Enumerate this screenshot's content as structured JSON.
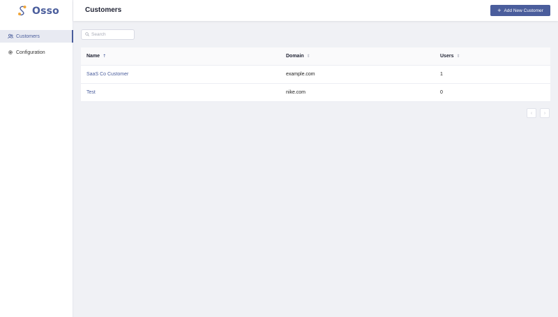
{
  "app": {
    "name": "Osso"
  },
  "sidebar": {
    "items": [
      {
        "label": "Customers",
        "icon": "users-icon",
        "active": true
      },
      {
        "label": "Configuration",
        "icon": "gear-icon",
        "active": false
      }
    ]
  },
  "header": {
    "title": "Customers",
    "add_button_label": "Add New Customer"
  },
  "search": {
    "placeholder": "Search",
    "value": ""
  },
  "table": {
    "columns": [
      "Name",
      "Domain",
      "Users"
    ],
    "rows": [
      {
        "name": "SaaS Co Customer",
        "domain": "example.com",
        "users": "1"
      },
      {
        "name": "Test",
        "domain": "nike.com",
        "users": "0"
      }
    ]
  },
  "pagination": {
    "prev": "‹",
    "next": "›"
  },
  "colors": {
    "accent": "#4a5d9c",
    "background": "#f0f1f5",
    "logo_orange": "#f0a63a"
  }
}
